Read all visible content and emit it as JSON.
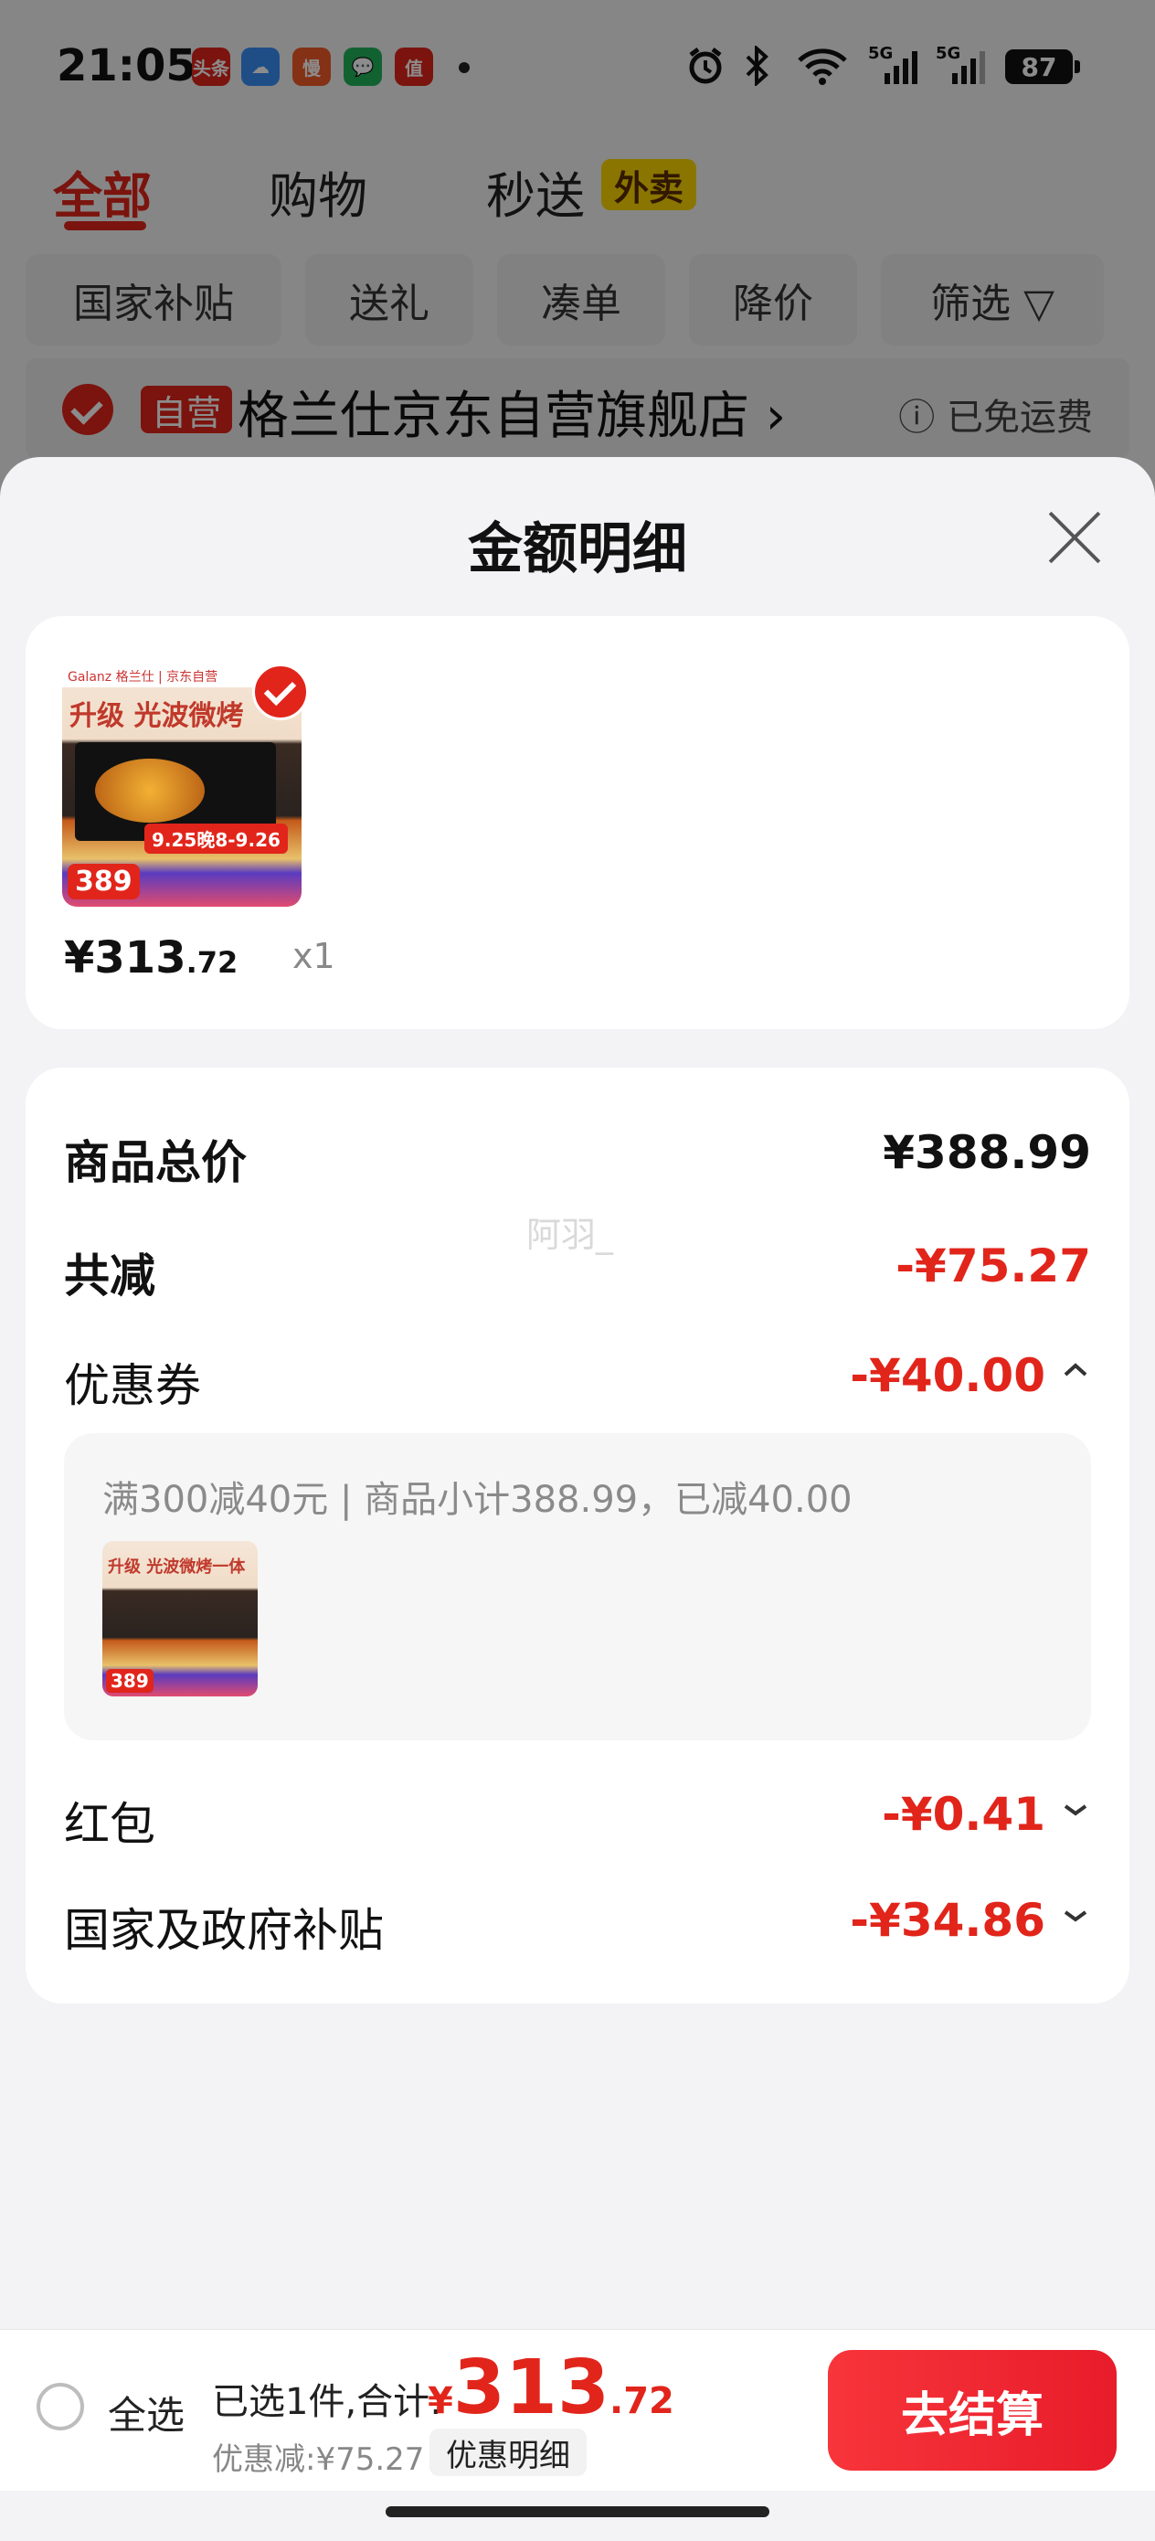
{
  "status_bar": {
    "time": "21:05",
    "notifications": [
      {
        "label": "头条",
        "color": "#e1251b"
      },
      {
        "label": "☁",
        "color": "#3a8ef6"
      },
      {
        "label": "慢",
        "color": "#f05a28"
      },
      {
        "label": "💬",
        "color": "#22b35a"
      },
      {
        "label": "值",
        "color": "#e1251b"
      }
    ],
    "network": "5G",
    "network2": "5G",
    "battery": "87"
  },
  "tabs": [
    {
      "label": "全部"
    },
    {
      "label": "购物"
    },
    {
      "label": "秒送"
    }
  ],
  "tab_badge": "外卖",
  "filter_chips": [
    {
      "label": "国家补贴"
    },
    {
      "label": "送礼"
    },
    {
      "label": "凑单"
    },
    {
      "label": "降价"
    },
    {
      "label": "筛选 ▽"
    }
  ],
  "store": {
    "self_tag": "自营",
    "name": "格兰仕京东自营旗舰店 ›",
    "shipping": "ⓘ 已免运费"
  },
  "sheet": {
    "title": "金额明细",
    "item": {
      "image_brand": "Galanz 格兰仕 | 京东自营",
      "image_title": "升级 光波微烤",
      "image_date": "9.25晚8-9.26",
      "image_price": "389",
      "price_int": "¥313",
      "price_dec": ".72",
      "qty": "x1"
    },
    "breakdown": {
      "total_label": "商品总价",
      "total_value": "¥388.99",
      "watermark": "阿羽_",
      "reduce_label": "共减",
      "reduce_value": "-¥75.27",
      "coupon_label": "优惠券",
      "coupon_value": "-¥40.00",
      "coupon_detail": "满300减40元 | 商品小计388.99，已减40.00",
      "coupon_thumb_title": "升级 光波微烤一体",
      "coupon_thumb_price": "389",
      "redpacket_label": "红包",
      "redpacket_value": "-¥0.41",
      "subsidy_label": "国家及政府补贴",
      "subsidy_value": "-¥34.86"
    }
  },
  "bottom_bar": {
    "select_all": "全选",
    "summary": "已选1件,合计:",
    "total_symbol": "¥",
    "total_int": "313",
    "total_dec": ".72",
    "discount": "优惠减:¥75.27",
    "detail_button": "优惠明细",
    "checkout_button": "去结算"
  },
  "colors": {
    "accent": "#e1251b",
    "checkout": "#f7353a"
  }
}
